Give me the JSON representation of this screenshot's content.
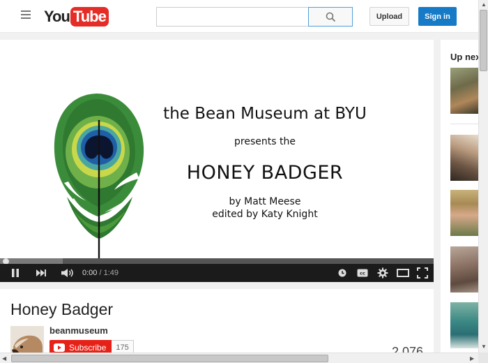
{
  "header": {
    "logo_you": "You",
    "logo_tube": "Tube",
    "search_placeholder": "",
    "upload_label": "Upload",
    "signin_label": "Sign in"
  },
  "player": {
    "slide": {
      "museum": "the Bean Museum at BYU",
      "presents": "presents the",
      "title": "HONEY BADGER",
      "by": "by Matt Meese",
      "edited": "edited by Katy Knight"
    },
    "current_time": "0:00",
    "separator": " / ",
    "duration": "1:49",
    "progress_fraction": 0.0
  },
  "video": {
    "title": "Honey Badger",
    "channel": "beanmuseum",
    "subscribe_label": "Subscribe",
    "subscriber_count": "175",
    "views_partial": "2,076"
  },
  "sidebar": {
    "up_next_label": "Up next"
  },
  "colors": {
    "brand_red": "#e52d27",
    "signin_blue": "#167ac6",
    "subscribe_red": "#e62117",
    "control_bar": "#1b1b1b"
  }
}
